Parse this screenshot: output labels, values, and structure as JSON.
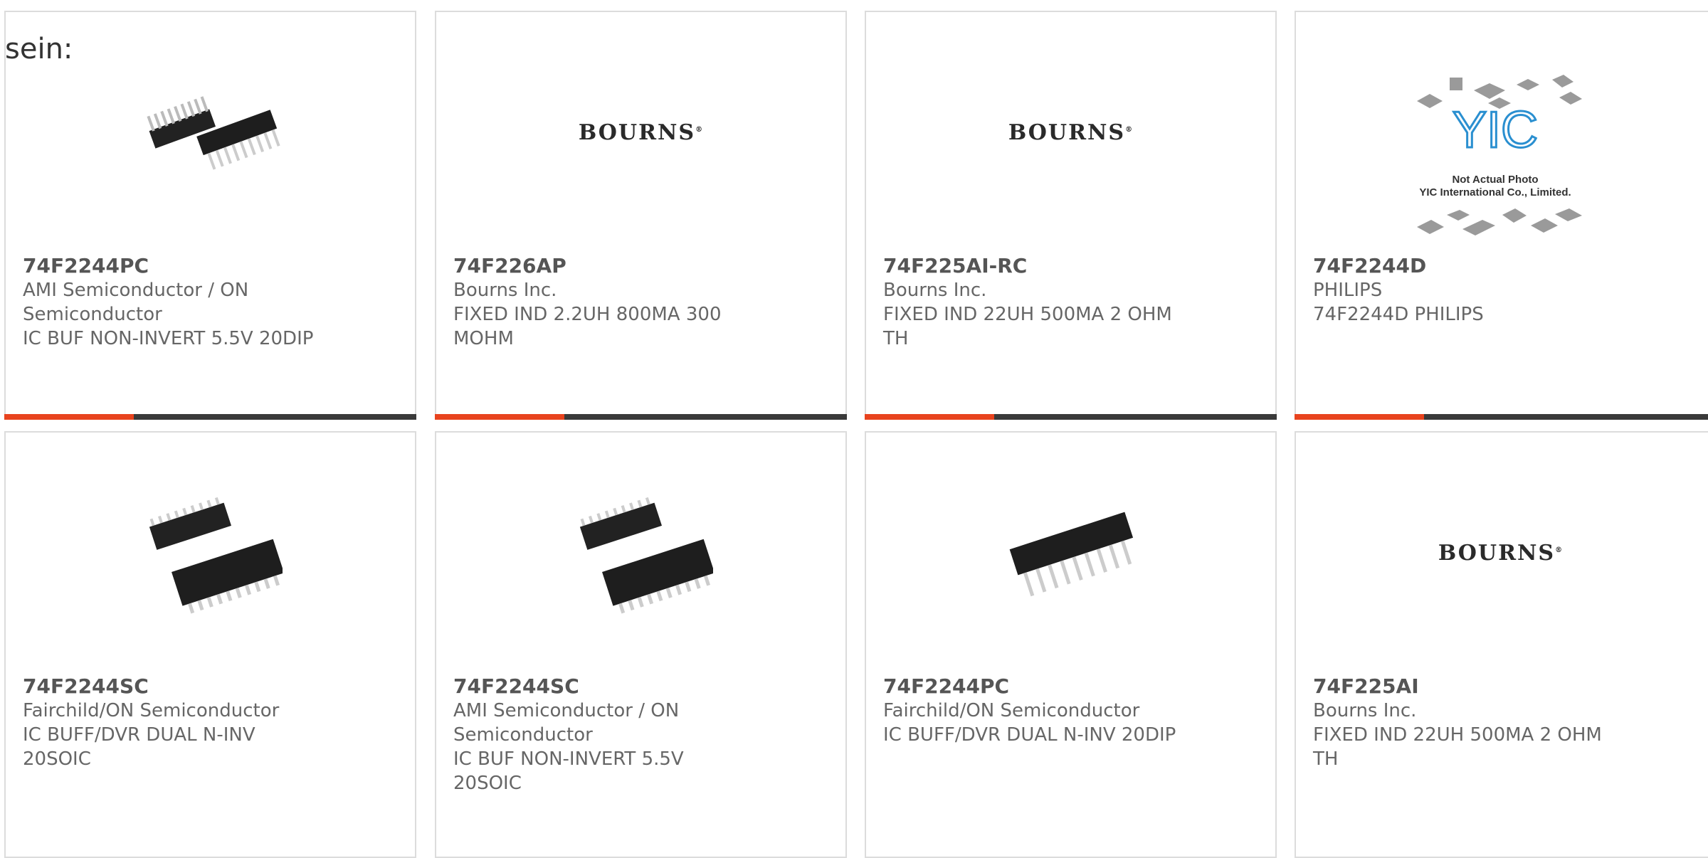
{
  "lead_text": "sein:",
  "products": [
    {
      "part": "74F2244PC",
      "maker": "AMI Semiconductor / ON Semiconductor",
      "maker_lines": [
        "AMI Semiconductor / ON",
        "Semiconductor"
      ],
      "desc_lines": [
        "IC BUF NON-INVERT 5.5V 20DIP"
      ],
      "image": "dip-ic-icon"
    },
    {
      "part": "74F226AP",
      "maker_lines": [
        "Bourns Inc."
      ],
      "desc_lines": [
        "FIXED IND 2.2UH 800MA 300",
        "MOHM"
      ],
      "image": "bourns-logo"
    },
    {
      "part": "74F225AI-RC",
      "maker_lines": [
        "Bourns Inc."
      ],
      "desc_lines": [
        "FIXED IND 22UH 500MA 2 OHM",
        "TH"
      ],
      "image": "bourns-logo"
    },
    {
      "part": "74F2244D",
      "maker_lines": [
        "PHILIPS"
      ],
      "desc_lines": [
        "74F2244D PHILIPS"
      ],
      "image": "yic-placeholder"
    },
    {
      "part": "74F2244SC",
      "maker_lines": [
        "Fairchild/ON Semiconductor"
      ],
      "desc_lines": [
        "IC BUFF/DVR DUAL N-INV",
        "20SOIC"
      ],
      "image": "soic-ic-icon"
    },
    {
      "part": "74F2244SC",
      "maker_lines": [
        "AMI Semiconductor / ON",
        "Semiconductor"
      ],
      "desc_lines": [
        "IC BUF NON-INVERT 5.5V",
        "20SOIC"
      ],
      "image": "soic-ic-icon"
    },
    {
      "part": "74F2244PC",
      "maker_lines": [
        "Fairchild/ON Semiconductor"
      ],
      "desc_lines": [
        "IC BUFF/DVR DUAL N-INV 20DIP"
      ],
      "image": "dip-ic-single-icon"
    },
    {
      "part": "74F225AI",
      "maker_lines": [
        "Bourns Inc."
      ],
      "desc_lines": [
        "FIXED IND 22UH 500MA 2 OHM",
        "TH"
      ],
      "image": "bourns-logo"
    }
  ],
  "logos": {
    "bourns": "BOURNS",
    "yic_line1": "Not Actual Photo",
    "yic_line2": "YIC International Co., Limited."
  },
  "colors": {
    "accent": "#e8431e",
    "bar": "#3a3a3a",
    "border": "#dcdcdc"
  }
}
